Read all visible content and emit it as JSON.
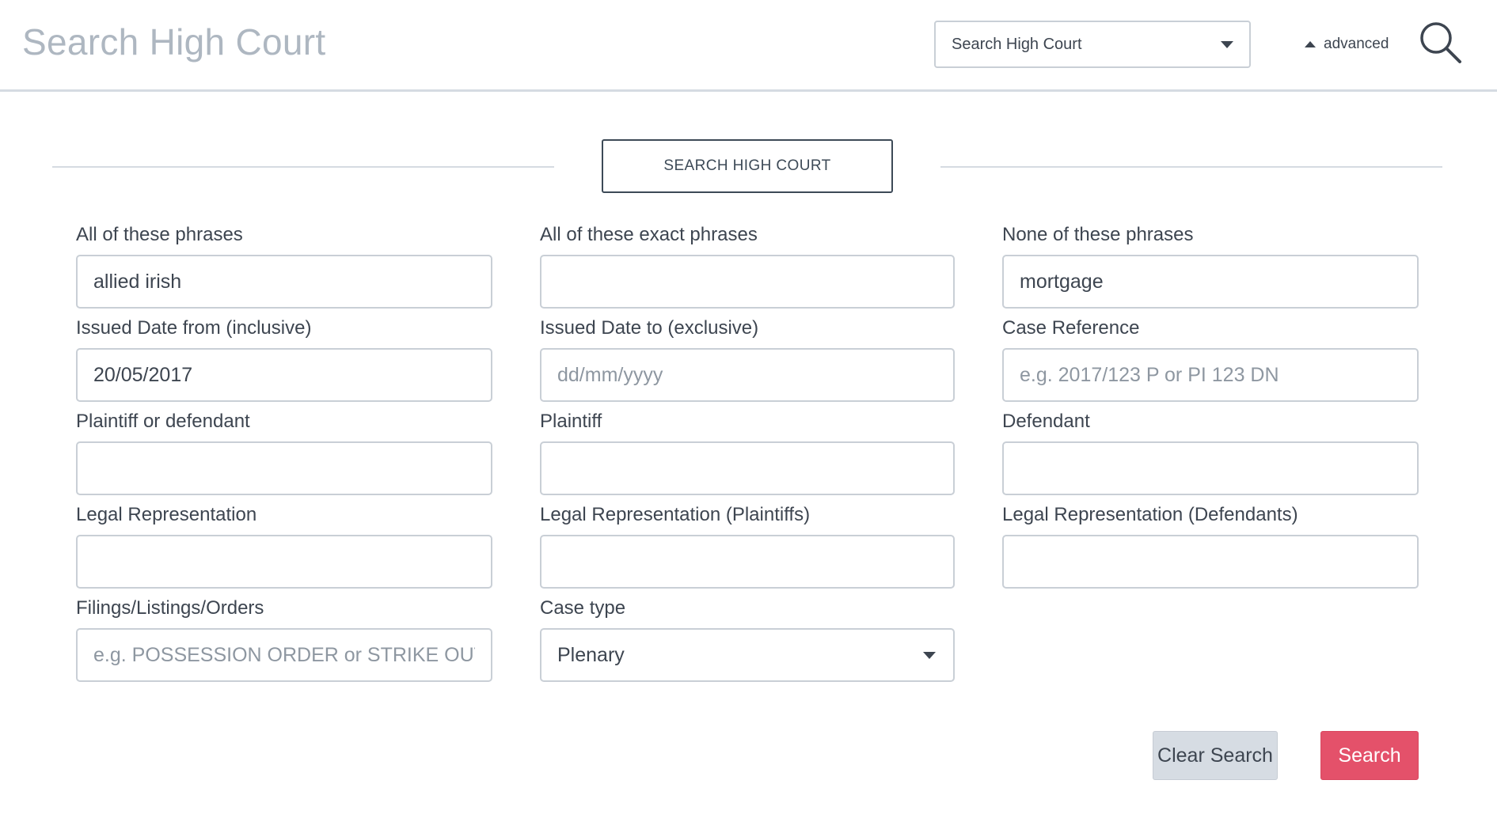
{
  "header": {
    "title": "Search High Court",
    "scope_select": {
      "value": "Search High Court"
    },
    "advanced_label": "advanced",
    "search_icon": "search-icon"
  },
  "section": {
    "button_label": "SEARCH HIGH COURT"
  },
  "form": {
    "all_phrases": {
      "label": "All of these phrases",
      "value": "allied irish",
      "placeholder": ""
    },
    "exact_phrases": {
      "label": "All of these exact phrases",
      "value": "",
      "placeholder": ""
    },
    "none_phrases": {
      "label": "None of these phrases",
      "value": "mortgage",
      "placeholder": ""
    },
    "date_from": {
      "label": "Issued Date from (inclusive)",
      "value": "20/05/2017",
      "placeholder": ""
    },
    "date_to": {
      "label": "Issued Date to (exclusive)",
      "value": "",
      "placeholder": "dd/mm/yyyy"
    },
    "case_reference": {
      "label": "Case Reference",
      "value": "",
      "placeholder": "e.g. 2017/123 P or PI 123 DN"
    },
    "plaintiff_or_defendant": {
      "label": "Plaintiff or defendant",
      "value": "",
      "placeholder": ""
    },
    "plaintiff": {
      "label": "Plaintiff",
      "value": "",
      "placeholder": ""
    },
    "defendant": {
      "label": "Defendant",
      "value": "",
      "placeholder": ""
    },
    "legal_rep": {
      "label": "Legal Representation",
      "value": "",
      "placeholder": ""
    },
    "legal_rep_plaintiffs": {
      "label": "Legal Representation (Plaintiffs)",
      "value": "",
      "placeholder": ""
    },
    "legal_rep_defendants": {
      "label": "Legal Representation (Defendants)",
      "value": "",
      "placeholder": ""
    },
    "filings": {
      "label": "Filings/Listings/Orders",
      "value": "",
      "placeholder": "e.g. POSSESSION ORDER or STRIKE OUT"
    },
    "case_type": {
      "label": "Case type",
      "value": "Plenary"
    }
  },
  "actions": {
    "clear_label": "Clear Search",
    "search_label": "Search"
  },
  "colors": {
    "accent": "#e4516a",
    "secondary_button": "#d6dce3",
    "title_gray": "#aeb7c1",
    "border": "#c9cfd6"
  }
}
